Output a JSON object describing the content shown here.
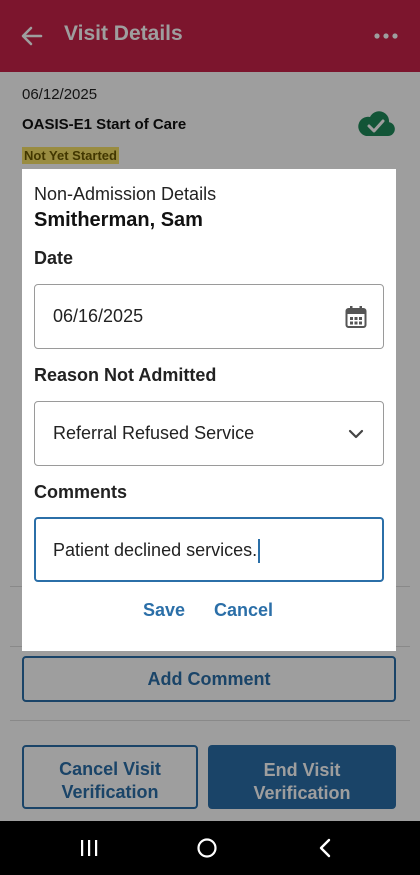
{
  "app_bar": {
    "title": "Visit Details",
    "back_icon": "arrow-left-icon",
    "more_icon": "more-horizontal-icon",
    "color": "#c8234a"
  },
  "visit": {
    "date": "06/12/2025",
    "type": "OASIS-E1 Start of Care",
    "status": "Not Yet Started",
    "sync_icon": "cloud-check-icon"
  },
  "page_actions": {
    "add_comment": "Add Comment",
    "cancel_verification": "Cancel Visit Verification",
    "end_verification": "End Visit Verification"
  },
  "dialog": {
    "title": "Non-Admission Details",
    "patient_name": "Smitherman, Sam",
    "date_label": "Date",
    "date_value": "06/16/2025",
    "date_icon": "calendar-icon",
    "reason_label": "Reason Not Admitted",
    "reason_value": "Referral Refused Service",
    "reason_icon": "chevron-down-icon",
    "comments_label": "Comments",
    "comments_value": "Patient declined services.",
    "save_label": "Save",
    "cancel_label": "Cancel"
  },
  "nav": {
    "recents_icon": "recents-icon",
    "home_icon": "home-circle-icon",
    "back_icon": "nav-back-icon"
  },
  "colors": {
    "primary": "#2b6fa8",
    "status_highlight": "#f7e26a",
    "success": "#1e8a5a"
  }
}
